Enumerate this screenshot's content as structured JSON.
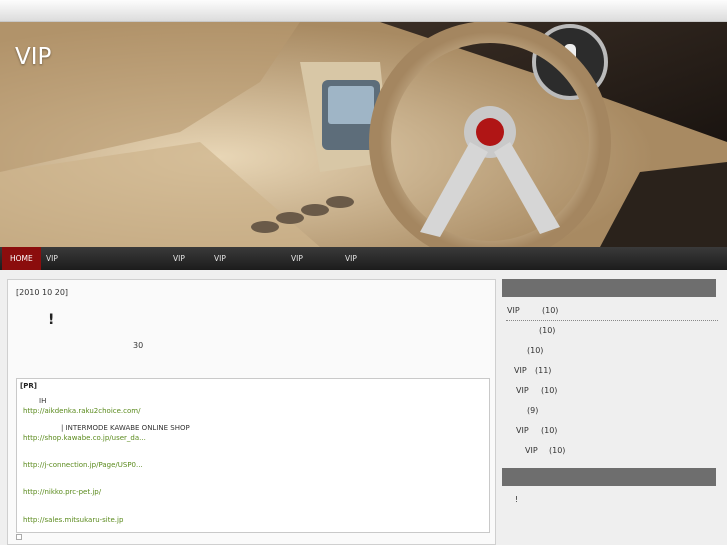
{
  "site": {
    "title": "VIP"
  },
  "nav": {
    "items": [
      {
        "label": "HOME"
      },
      {
        "label": "VIP"
      },
      {
        "label": "VIP"
      },
      {
        "label": "VIP"
      },
      {
        "label": "VIP"
      },
      {
        "label": "VIP"
      }
    ]
  },
  "post": {
    "date": "[2010  10  20]",
    "headline": "!",
    "body_number": "30"
  },
  "pr": {
    "title": "[PR]",
    "entries": [
      {
        "text": "IH",
        "link": "http://aikdenka.raku2choice.com/"
      },
      {
        "text": "| INTERMODE KAWABE ONLINE SHOP",
        "link": "http://shop.kawabe.co.jp/user_da..."
      },
      {
        "text": "",
        "link": "http://j-connection.jp/Page/USP0..."
      },
      {
        "text": "",
        "link": "http://nikko.prc-pet.jp/"
      },
      {
        "text": "",
        "link": "http://sales.mitsukaru-site.jp"
      }
    ]
  },
  "sidebar": {
    "categories": [
      {
        "label": "VIP",
        "count": "(10)"
      },
      {
        "label": "",
        "count": "(10)"
      },
      {
        "label": "",
        "count": "(10)"
      },
      {
        "label": "VIP",
        "count": "(11)"
      },
      {
        "label": "VIP",
        "count": "(10)"
      },
      {
        "label": "",
        "count": "(9)"
      },
      {
        "label": "VIP",
        "count": "(10)"
      },
      {
        "label": "VIP",
        "count": "(10)"
      }
    ],
    "second_block_text": "!"
  }
}
